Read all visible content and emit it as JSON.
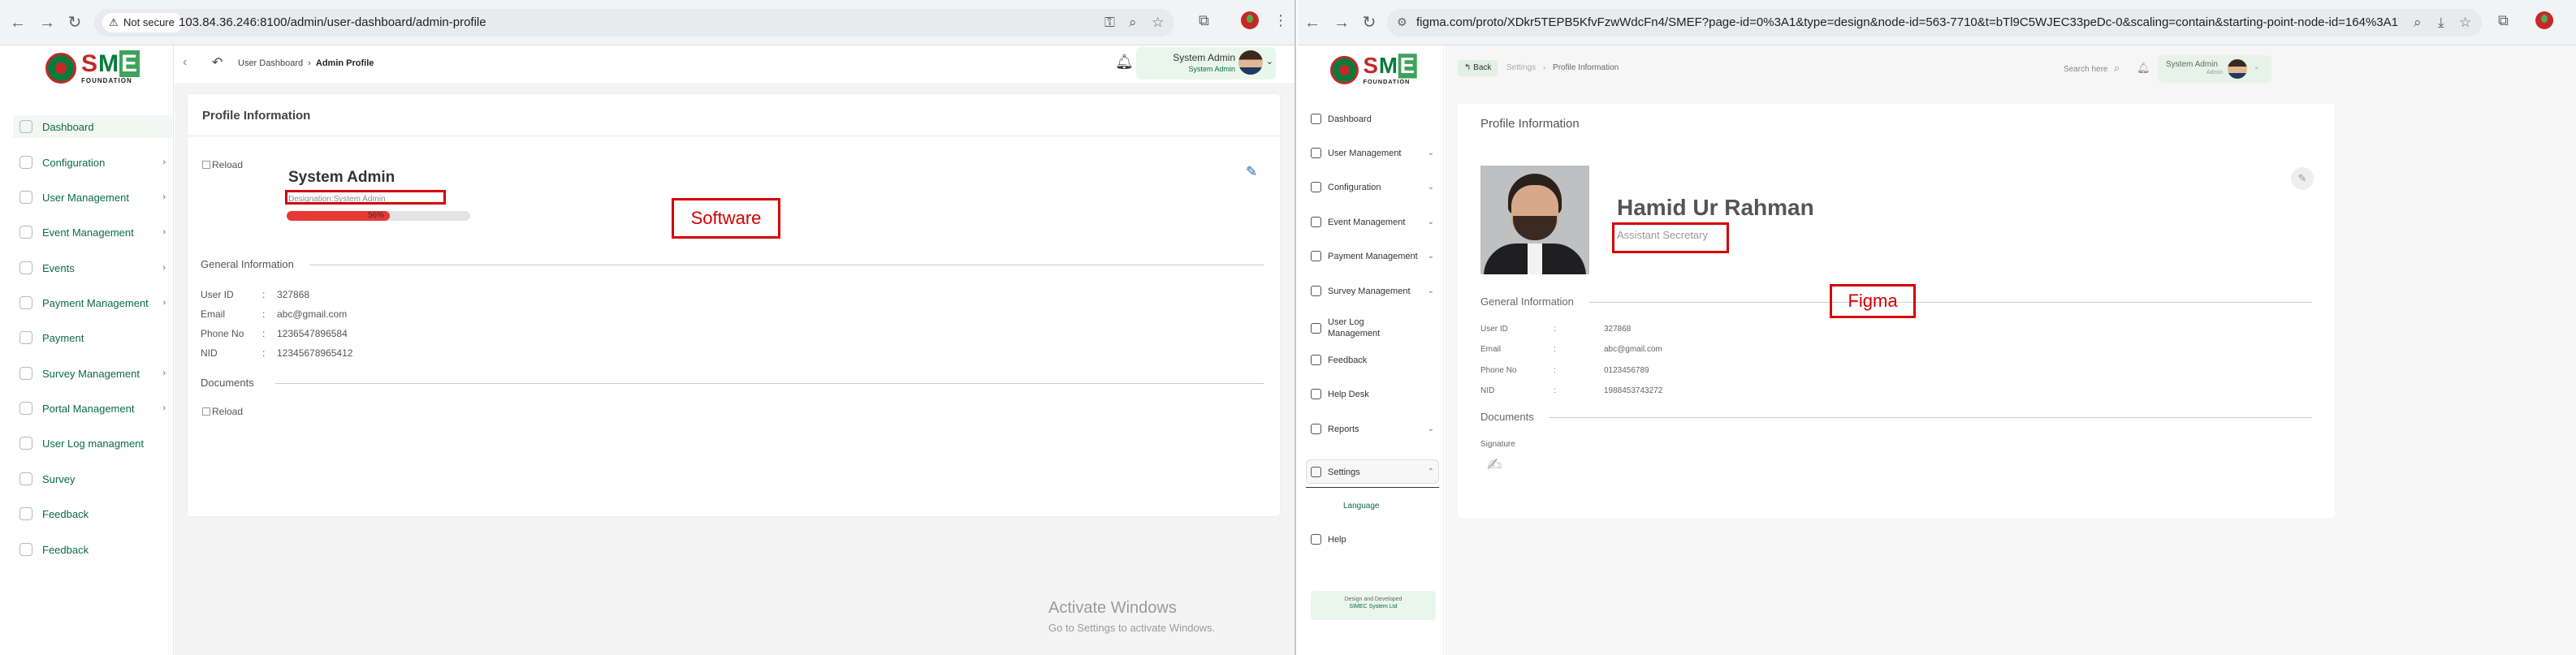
{
  "left": {
    "browser": {
      "not_secure": "Not secure",
      "url": "103.84.36.246:8100/admin/user-dashboard/admin-profile"
    },
    "logo": {
      "s": "S",
      "m": "M",
      "e": "E",
      "foundation": "FOUNDATION"
    },
    "sidebar": [
      {
        "label": "Dashboard",
        "chevron": ""
      },
      {
        "label": "Configuration",
        "chevron": "›"
      },
      {
        "label": "User Management",
        "chevron": "›"
      },
      {
        "label": "Event Management",
        "chevron": "›"
      },
      {
        "label": "Events",
        "chevron": "›"
      },
      {
        "label": "Payment Management",
        "chevron": "›"
      },
      {
        "label": "Payment",
        "chevron": ""
      },
      {
        "label": "Survey Management",
        "chevron": "›"
      },
      {
        "label": "Portal Management",
        "chevron": "›"
      },
      {
        "label": "User Log managment",
        "chevron": ""
      },
      {
        "label": "Survey",
        "chevron": ""
      },
      {
        "label": "Feedback",
        "chevron": ""
      },
      {
        "label": "Feedback",
        "chevron": ""
      }
    ],
    "breadcrumb": {
      "parent": "User Dashboard",
      "separator": "›",
      "current": "Admin Profile"
    },
    "user": {
      "name": "System Admin",
      "role": "System Admin"
    },
    "card_title": "Profile Information",
    "profile_img_alt": "Reload",
    "profile_name": "System Admin",
    "designation": "Designation:System Admin",
    "progress": {
      "percent": 56,
      "label": "56%"
    },
    "general_heading": "General Information",
    "fields": [
      {
        "key": "User ID",
        "value": "327868"
      },
      {
        "key": "Email",
        "value": "abc@gmail.com"
      },
      {
        "key": "Phone No",
        "value": "1236547896584"
      },
      {
        "key": "NID",
        "value": "12345678965412"
      }
    ],
    "colon": ":",
    "documents_heading": "Documents",
    "document_img_alt": "Reload",
    "annotation": "Software",
    "watermark": {
      "title": "Activate Windows",
      "subtitle": "Go to Settings to activate Windows."
    }
  },
  "right": {
    "browser": {
      "url": "figma.com/proto/XDkr5TEPB5KfvFzwWdcFn4/SMEF?page-id=0%3A1&type=design&node-id=563-7710&t=bTl9C5WJEC33peDc-0&scaling=contain&starting-point-node-id=164%3A17237&conten..."
    },
    "logo": {
      "s": "S",
      "m": "M",
      "e": "E",
      "foundation": "FOUNDATION"
    },
    "sidebar": [
      {
        "label": "Dashboard",
        "chevron": ""
      },
      {
        "label": "User Management",
        "chevron": "⌄"
      },
      {
        "label": "Configuration",
        "chevron": "⌄"
      },
      {
        "label": "Event Management",
        "chevron": "⌄"
      },
      {
        "label": "Payment Management",
        "chevron": "⌄"
      },
      {
        "label": "Survey Management",
        "chevron": "⌄"
      },
      {
        "label": "User Log Management",
        "chevron": ""
      },
      {
        "label": "Feedback",
        "chevron": ""
      },
      {
        "label": "Help Desk",
        "chevron": ""
      },
      {
        "label": "Reports",
        "chevron": "⌄"
      },
      {
        "label": "Settings",
        "chevron": "⌃"
      },
      {
        "label": "Help",
        "chevron": ""
      }
    ],
    "settings_sub": "Language",
    "footer_credit": {
      "line1": "Design and Developed",
      "line2": "SIMEC System Ltd"
    },
    "back_label": "Back",
    "breadcrumb": {
      "parent": "Settings",
      "separator": "›",
      "current": "Profile Information"
    },
    "search_label": "Search here",
    "user": {
      "name": "System Admin",
      "role": "Admin"
    },
    "card_title": "Profile Information",
    "profile_name": "Hamid Ur Rahman",
    "designation": "Assistant Secretary",
    "general_heading": "General Information",
    "fields": [
      {
        "key": "User ID",
        "value": "327868"
      },
      {
        "key": "Email",
        "value": "abc@gmail.com"
      },
      {
        "key": "Phone No",
        "value": "0123456789"
      },
      {
        "key": "NID",
        "value": "1988453743272"
      }
    ],
    "colon": ":",
    "documents_heading": "Documents",
    "signature_label": "Signature",
    "annotation": "Figma"
  },
  "colors": {
    "accent_green": "#0b6b45",
    "annotation_red": "#d40000",
    "progress_red": "#e53935",
    "chip_green": "#e9f6ec"
  }
}
